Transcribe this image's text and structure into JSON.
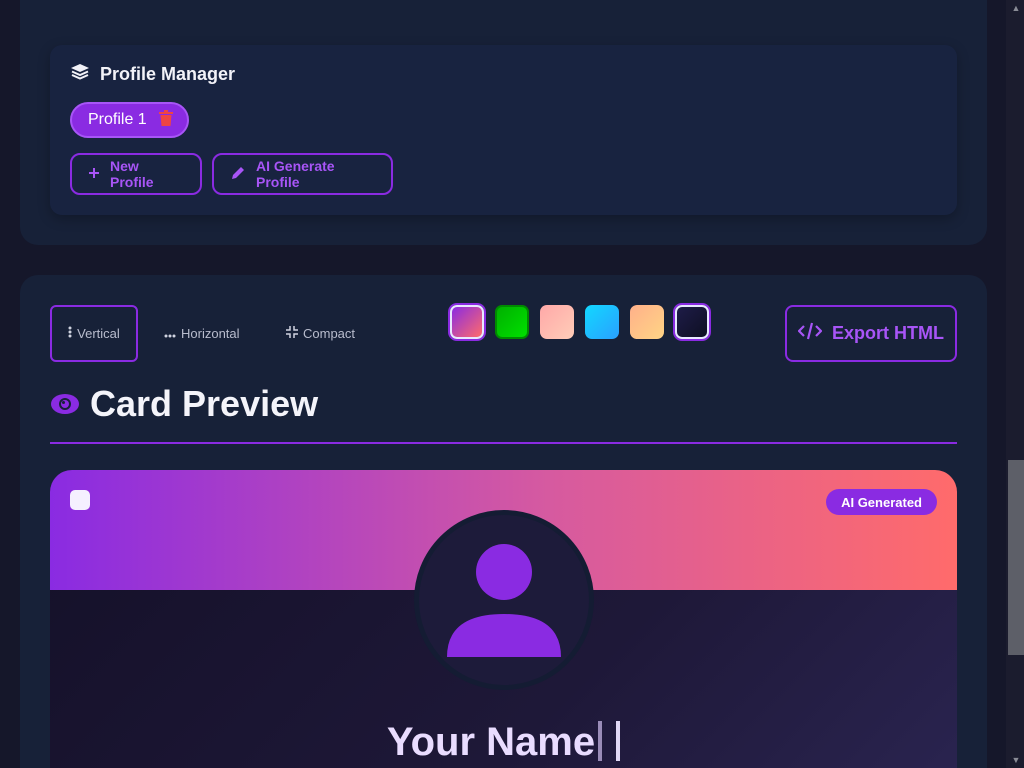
{
  "profile_manager": {
    "title": "Profile Manager",
    "profiles": [
      {
        "label": "Profile 1"
      }
    ],
    "new_profile_label": "New Profile",
    "ai_generate_label": "AI Generate Profile"
  },
  "toolbar": {
    "layouts": [
      {
        "label": "Vertical",
        "selected": true
      },
      {
        "label": "Horizontal",
        "selected": false
      },
      {
        "label": "Compact",
        "selected": false
      }
    ],
    "themes": [
      {
        "color": "#8a2be2",
        "color2": "#ff6b6b",
        "selected": true
      },
      {
        "color": "#00c800",
        "color2": "#00c800",
        "selected": false
      },
      {
        "color": "#ffb0b0",
        "color2": "#ffc9b8",
        "selected": false
      },
      {
        "color": "#18d0ff",
        "color2": "#2aa9ff",
        "selected": false
      },
      {
        "color": "#ffb48a",
        "color2": "#ffd080",
        "selected": false
      },
      {
        "color": "#1a1840",
        "color2": "#0f1024",
        "selected": true
      }
    ],
    "export_label": "Export HTML"
  },
  "preview": {
    "title": "Card Preview",
    "badge": "AI Generated",
    "name": "Your Name"
  },
  "colors": {
    "accent": "#8a2be2",
    "green": "#10b981",
    "danger": "#ef4444"
  }
}
